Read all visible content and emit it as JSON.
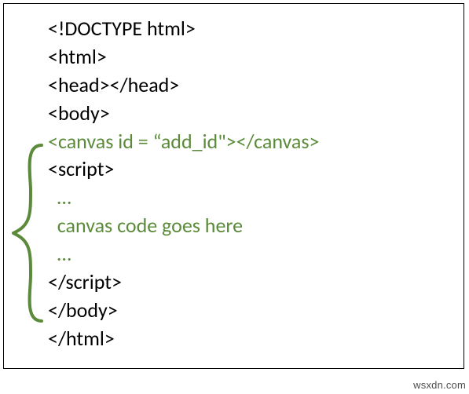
{
  "code": {
    "l1": "<!DOCTYPE html>",
    "l2": "<html>",
    "l3": "<head></head>",
    "l4": "<body>",
    "l5": "<canvas id = “add_id\"></canvas>",
    "l6": "<script>",
    "l7": "  …",
    "l8": "  canvas code goes here",
    "l9": "  …",
    "l10": "</script>",
    "l11": "</body>",
    "l12": "</html>"
  },
  "watermark": "wsxdn.com"
}
